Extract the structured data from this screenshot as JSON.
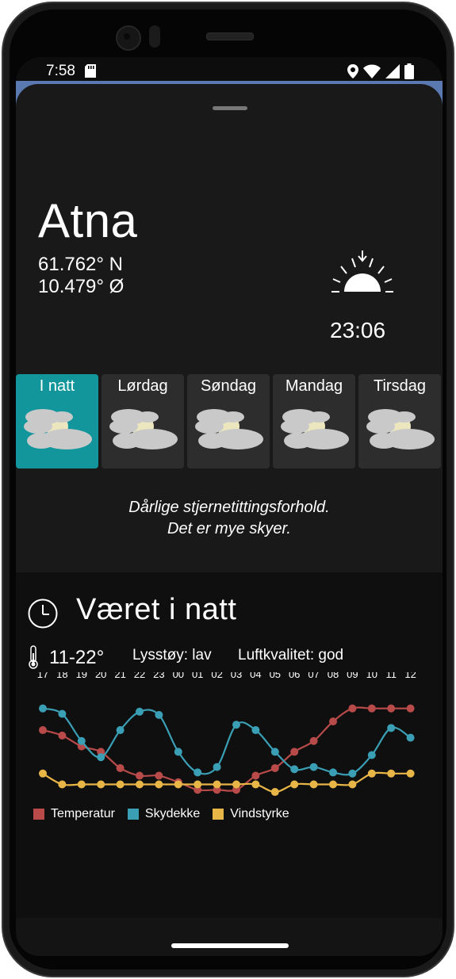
{
  "status": {
    "time": "7:58"
  },
  "location": {
    "name": "Atna",
    "lat": "61.762° N",
    "lon": "10.479° Ø"
  },
  "sunset": {
    "time": "23:06"
  },
  "days": [
    {
      "label": "I natt",
      "active": true
    },
    {
      "label": "Lørdag",
      "active": false
    },
    {
      "label": "Søndag",
      "active": false
    },
    {
      "label": "Mandag",
      "active": false
    },
    {
      "label": "Tirsdag",
      "active": false
    }
  ],
  "forecast": {
    "line1": "Dårlige stjernetittingsforhold.",
    "line2": "Det er mye skyer."
  },
  "tonight": {
    "title": "Været i natt",
    "temp_range": "11-22°",
    "light_pollution": "Lysstøy: lav",
    "air_quality": "Luftkvalitet: god"
  },
  "chart_data": {
    "type": "line",
    "categories": [
      "17",
      "18",
      "19",
      "20",
      "21",
      "22",
      "23",
      "00",
      "01",
      "02",
      "03",
      "04",
      "05",
      "06",
      "07",
      "08",
      "09",
      "10",
      "11",
      "12"
    ],
    "series": [
      {
        "name": "Temperatur",
        "color": "#b84a4a",
        "values": [
          9.0,
          8.5,
          7.5,
          7.0,
          5.5,
          4.8,
          4.8,
          4.2,
          3.5,
          3.5,
          3.5,
          4.8,
          5.5,
          7.0,
          8.0,
          9.8,
          11.0,
          11.0,
          11.0,
          11.0
        ]
      },
      {
        "name": "Skydekke",
        "color": "#3a9fb5",
        "values": [
          11.0,
          10.5,
          8.0,
          6.5,
          9.0,
          10.7,
          10.4,
          7.0,
          5.1,
          5.6,
          9.5,
          9.0,
          7.0,
          5.4,
          5.6,
          5.1,
          5.0,
          6.7,
          9.2,
          8.3
        ]
      },
      {
        "name": "Vindstyrke",
        "color": "#e8b547",
        "values": [
          5.0,
          4.0,
          4.0,
          4.0,
          4.0,
          4.0,
          4.0,
          4.0,
          4.0,
          4.0,
          4.0,
          4.0,
          3.3,
          4.0,
          4.0,
          4.0,
          4.0,
          5.0,
          5.0,
          5.0
        ]
      }
    ],
    "ylim": [
      2.5,
      12
    ],
    "grid": false,
    "legend": "bottom-left"
  }
}
